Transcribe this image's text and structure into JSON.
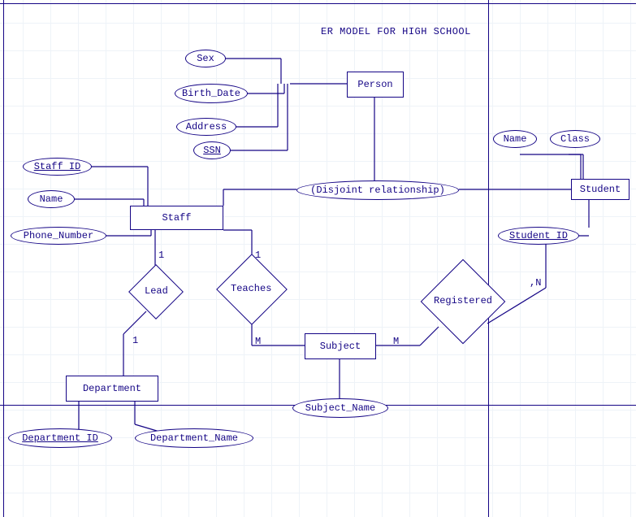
{
  "title": "ER MODEL FOR HIGH SCHOOL",
  "entities": {
    "person": "Person",
    "staff": "Staff",
    "student": "Student",
    "subject": "Subject",
    "department": "Department"
  },
  "attributes": {
    "sex": "Sex",
    "birth_date": "Birth_Date",
    "address": "Address",
    "ssn": "SSN",
    "staff_id": "Staff ID",
    "staff_name": "Name",
    "phone": "Phone_Number",
    "student_name": "Name",
    "class": "Class",
    "student_id": "Student ID",
    "subject_name": "Subject_Name",
    "department_id": "Department ID",
    "department_name": "Department_Name",
    "disjoint": "(Disjoint relationship)"
  },
  "relationships": {
    "teaches": "Teaches",
    "registered": "Registered",
    "lead": "Lead"
  },
  "cardinality": {
    "staff_lead": "1",
    "lead_dept": "1",
    "staff_teach": "1",
    "teach_subj": "M",
    "subj_reg": "M",
    "reg_student": ",N"
  }
}
